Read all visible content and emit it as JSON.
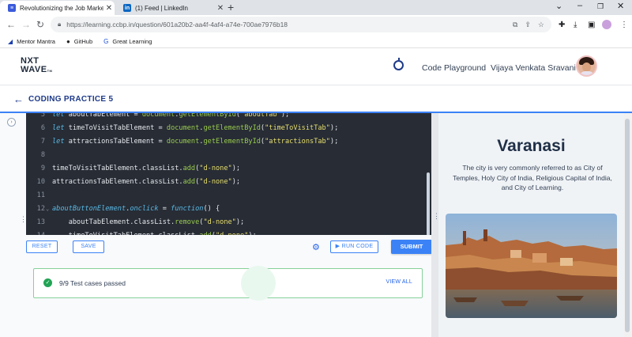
{
  "browser": {
    "tabs": [
      {
        "title": "Revolutionizing the Job Market |",
        "favicon": "nxtwave-favicon",
        "active": true
      },
      {
        "title": "(1) Feed | LinkedIn",
        "favicon": "linkedin-favicon",
        "active": false
      }
    ],
    "url": "https://learning.ccbp.in/question/601a20b2-aa4f-4af4-a74e-700ae7976b18",
    "bookmarks": [
      {
        "label": "Mentor Mantra",
        "icon": "mentor-mantra-icon"
      },
      {
        "label": "GitHub",
        "icon": "github-icon"
      },
      {
        "label": "Great Learning",
        "icon": "great-learning-icon"
      }
    ],
    "linkedin_favicon_text": "in"
  },
  "app": {
    "logo_line1": "NXT",
    "logo_line2": "WAVE",
    "logo_tm": "TM",
    "code_playground": "Code Playground",
    "user_name": "Vijaya Venkata Sravani",
    "practice_title": "CODING PRACTICE 5"
  },
  "editor": {
    "lines": [
      {
        "num": "5",
        "tokens": [
          {
            "t": "let ",
            "c": "kw"
          },
          {
            "t": "aboutTabElement = ",
            "c": "plain"
          },
          {
            "t": "document",
            "c": "fn"
          },
          {
            "t": ".",
            "c": "plain"
          },
          {
            "t": "getElementById",
            "c": "fn"
          },
          {
            "t": "(",
            "c": "plain"
          },
          {
            "t": "\"aboutTab\"",
            "c": "str"
          },
          {
            "t": ");",
            "c": "plain"
          }
        ]
      },
      {
        "num": "6",
        "tokens": [
          {
            "t": "let ",
            "c": "kw"
          },
          {
            "t": "timeToVisitTabElement = ",
            "c": "plain"
          },
          {
            "t": "document",
            "c": "fn"
          },
          {
            "t": ".",
            "c": "plain"
          },
          {
            "t": "getElementById",
            "c": "fn"
          },
          {
            "t": "(",
            "c": "plain"
          },
          {
            "t": "\"timeToVisitTab\"",
            "c": "str"
          },
          {
            "t": ");",
            "c": "plain"
          }
        ]
      },
      {
        "num": "7",
        "tokens": [
          {
            "t": "let ",
            "c": "kw"
          },
          {
            "t": "attractionsTabElement = ",
            "c": "plain"
          },
          {
            "t": "document",
            "c": "fn"
          },
          {
            "t": ".",
            "c": "plain"
          },
          {
            "t": "getElementById",
            "c": "fn"
          },
          {
            "t": "(",
            "c": "plain"
          },
          {
            "t": "\"attractionsTab\"",
            "c": "str"
          },
          {
            "t": ");",
            "c": "plain"
          }
        ]
      },
      {
        "num": "8",
        "tokens": []
      },
      {
        "num": "9",
        "tokens": [
          {
            "t": "timeToVisitTabElement.classList.",
            "c": "plain"
          },
          {
            "t": "add",
            "c": "fn"
          },
          {
            "t": "(",
            "c": "plain"
          },
          {
            "t": "\"d-none\"",
            "c": "str"
          },
          {
            "t": ");",
            "c": "plain"
          }
        ]
      },
      {
        "num": "10",
        "tokens": [
          {
            "t": "attractionsTabElement.classList.",
            "c": "plain"
          },
          {
            "t": "add",
            "c": "fn"
          },
          {
            "t": "(",
            "c": "plain"
          },
          {
            "t": "\"d-none\"",
            "c": "str"
          },
          {
            "t": ");",
            "c": "plain"
          }
        ]
      },
      {
        "num": "11",
        "tokens": []
      },
      {
        "num": "12",
        "fold": true,
        "tokens": [
          {
            "t": "aboutButtonElement",
            "c": "kw"
          },
          {
            "t": ".",
            "c": "plain"
          },
          {
            "t": "onclick",
            "c": "kw"
          },
          {
            "t": " = ",
            "c": "plain"
          },
          {
            "t": "function",
            "c": "kw"
          },
          {
            "t": "() {",
            "c": "plain"
          }
        ]
      },
      {
        "num": "13",
        "tokens": [
          {
            "t": "    aboutTabElement.classList.",
            "c": "plain"
          },
          {
            "t": "remove",
            "c": "fn"
          },
          {
            "t": "(",
            "c": "plain"
          },
          {
            "t": "\"d-none\"",
            "c": "str"
          },
          {
            "t": ");",
            "c": "plain"
          }
        ]
      },
      {
        "num": "14",
        "tokens": [
          {
            "t": "    timeToVisitTabElement.classList.",
            "c": "plain"
          },
          {
            "t": "add",
            "c": "fn"
          },
          {
            "t": "(",
            "c": "plain"
          },
          {
            "t": "\"d-none\"",
            "c": "str"
          },
          {
            "t": ");",
            "c": "plain"
          }
        ]
      }
    ]
  },
  "controls": {
    "reset": "RESET",
    "save": "SAVE",
    "run_code": "RUN CODE",
    "submit": "SUBMIT"
  },
  "result": {
    "text": "9/9 Test cases passed",
    "view_all": "VIEW ALL"
  },
  "preview": {
    "title": "Varanasi",
    "description": "The city is very commonly referred to as City of Temples, Holy City of India, Religious Capital of India, and City of Learning."
  },
  "colors": {
    "accent": "#3b82f6",
    "success": "#22a355",
    "editor_bg": "#272c35",
    "brand_dark": "#1e3a8a"
  }
}
